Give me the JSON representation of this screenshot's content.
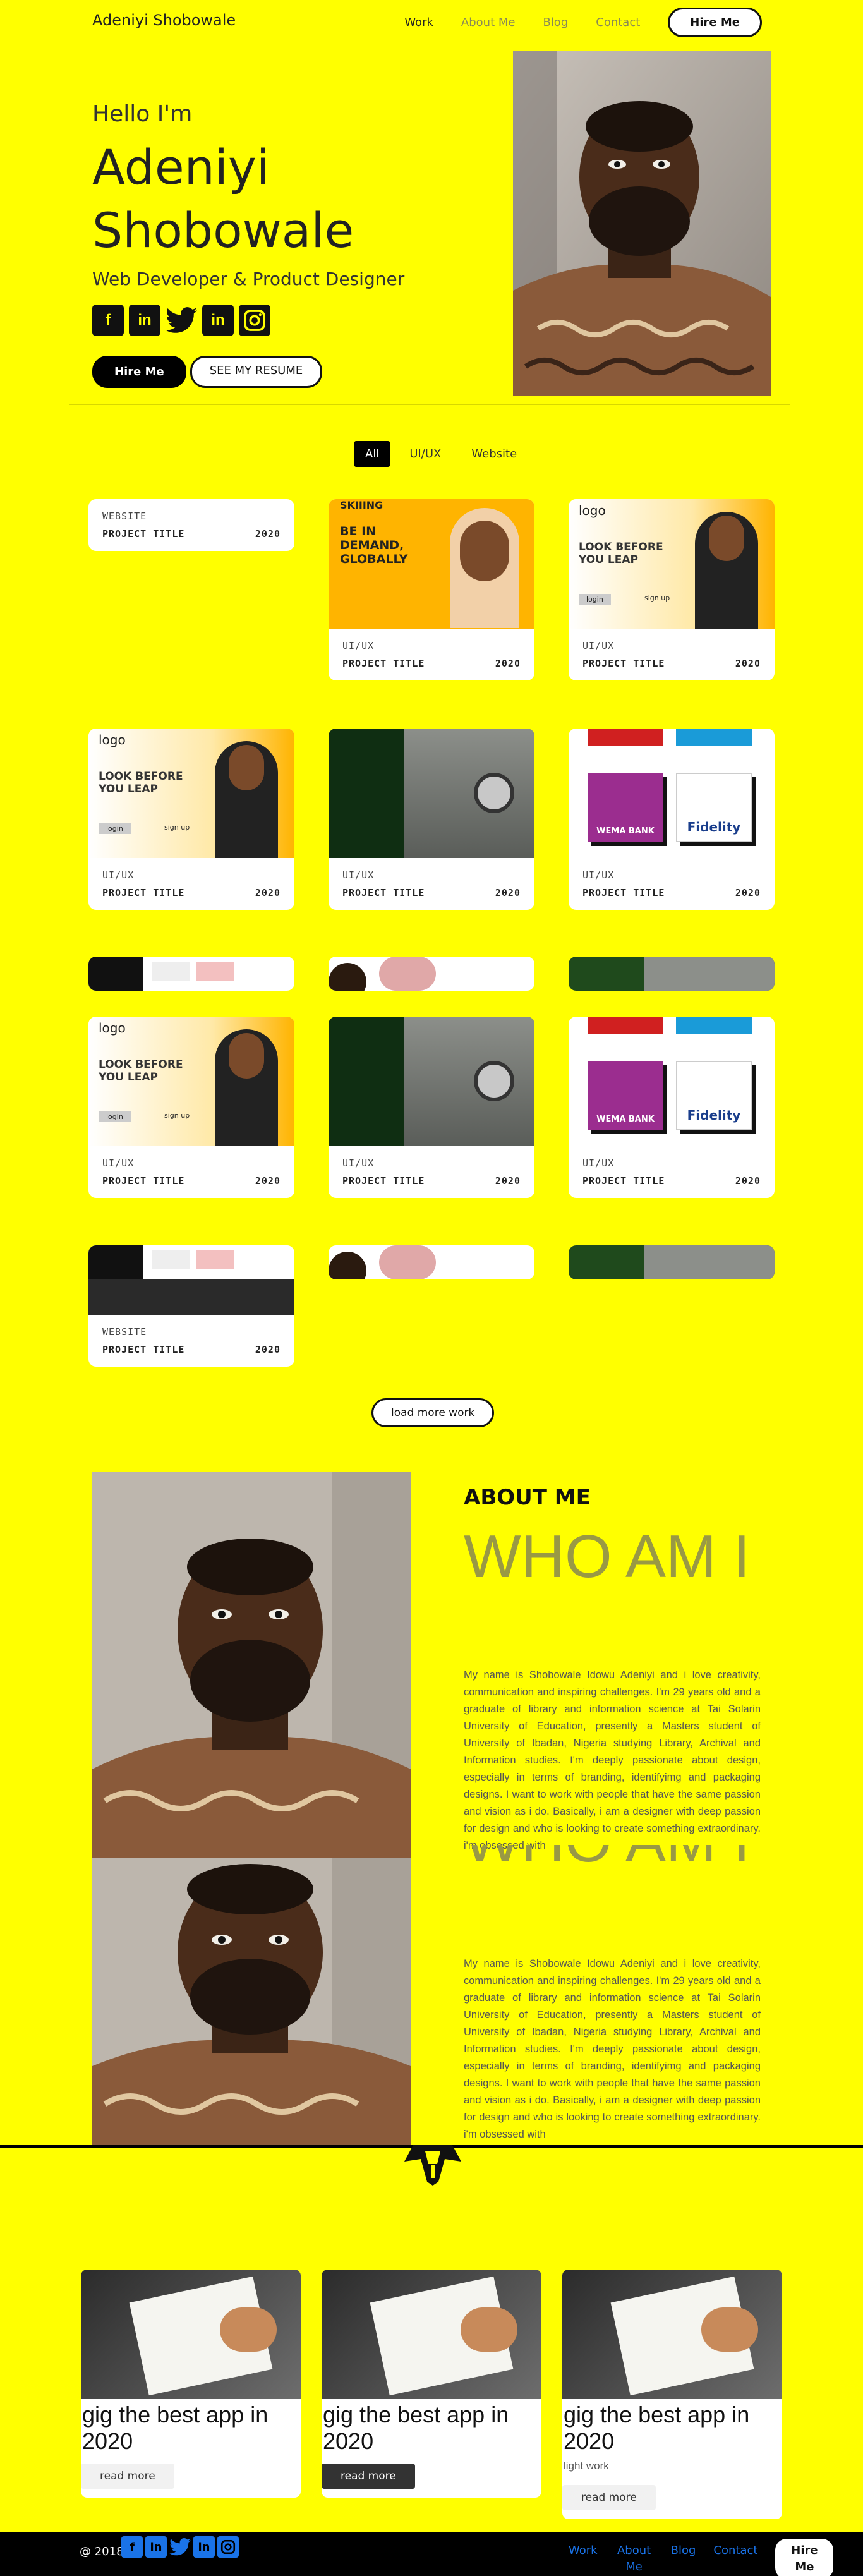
{
  "nav": {
    "brand": "Adeniyi Shobowale",
    "links": [
      "Work",
      "About Me",
      "Blog",
      "Contact"
    ],
    "hire": "Hire Me"
  },
  "hero": {
    "hello": "Hello I'm",
    "name": "Adeniyi Shobowale",
    "role": "Web Developer & Product Designer",
    "socials": [
      "facebook-icon",
      "linkedin-icon",
      "twitter-icon",
      "linkedin-icon",
      "instagram-icon"
    ],
    "primary_btn": "Hire Me",
    "secondary_btn": "SEE MY RESUME"
  },
  "filters": [
    "All",
    "UI/UX",
    "Website"
  ],
  "cards": [
    {
      "category": "WEBSITE",
      "title": "PROJECT TITLE",
      "year": "2020",
      "thumb": "none"
    },
    {
      "category": "UI/UX",
      "title": "PROJECT TITLE",
      "year": "2020",
      "thumb": "skiiling"
    },
    {
      "category": "UI/UX",
      "title": "PROJECT TITLE",
      "year": "2020",
      "thumb": "logo-leap"
    },
    {
      "category": "UI/UX",
      "title": "PROJECT TITLE",
      "year": "2020",
      "thumb": "logo-leap"
    },
    {
      "category": "UI/UX",
      "title": "PROJECT TITLE",
      "year": "2020",
      "thumb": "moto"
    },
    {
      "category": "UI/UX",
      "title": "PROJECT TITLE",
      "year": "2020",
      "thumb": "banks"
    },
    {
      "category": "UI/UX",
      "title": "PROJECT TITLE",
      "year": "2020",
      "thumb": "logo-leap"
    },
    {
      "category": "UI/UX",
      "title": "PROJECT TITLE",
      "year": "2020",
      "thumb": "moto"
    },
    {
      "category": "UI/UX",
      "title": "PROJECT TITLE",
      "year": "2020",
      "thumb": "banks"
    },
    {
      "category": "WEBSITE",
      "title": "PROJECT TITLE",
      "year": "2020",
      "thumb": "dash"
    }
  ],
  "thumb_text": {
    "skiiling_brand": "SKIIING",
    "skiiling_headline": "BE IN DEMAND, GLOBALLY",
    "leap_logo": "logo",
    "leap_headline": "LOOK BEFORE YOU LEAP",
    "leap_login": "login",
    "leap_signup": "sign up",
    "bank1": "WEMA BANK",
    "bank2": "Fidelity"
  },
  "load_more": "load more work",
  "about": {
    "kicker": "ABOUT ME",
    "heading": "WHO AM I",
    "body": "My name is Shobowale Idowu Adeniyi and i love creativity, communication and inspiring challenges. I'm 29 years old and a graduate of library and information science at Tai Solarin University of Education, presently a Masters student of University of Ibadan, Nigeria studying Library, Archival and Information studies. I'm deeply passionate about design, especially in terms of branding, identifyimg and packaging designs. I want to work with people that have the same passion and vision as i do. Basically, i am a designer with deep passion for design and who is looking to create something extraordinary. i'm obsessed with"
  },
  "blog": [
    {
      "title": "gig the best app in 2020",
      "subtitle": "",
      "read": "read more",
      "dark": false
    },
    {
      "title": "gig the best app in 2020",
      "subtitle": "",
      "read": "read more",
      "dark": true
    },
    {
      "title": "gig the best app in 2020",
      "subtitle": "light work",
      "read": "read more",
      "dark": false
    }
  ],
  "footer": {
    "copyright": "@ 2018",
    "icons": [
      "facebook-icon",
      "linkedin-icon",
      "twitter-icon",
      "linkedin-icon",
      "instagram-icon"
    ],
    "links": [
      "Work",
      "About Me",
      "Blog",
      "Contact"
    ],
    "hire": "Hire Me"
  },
  "colors": {
    "background": "#ffff00",
    "accent": "#000000",
    "link": "#1a73e8",
    "muted_heading": "#999944"
  }
}
